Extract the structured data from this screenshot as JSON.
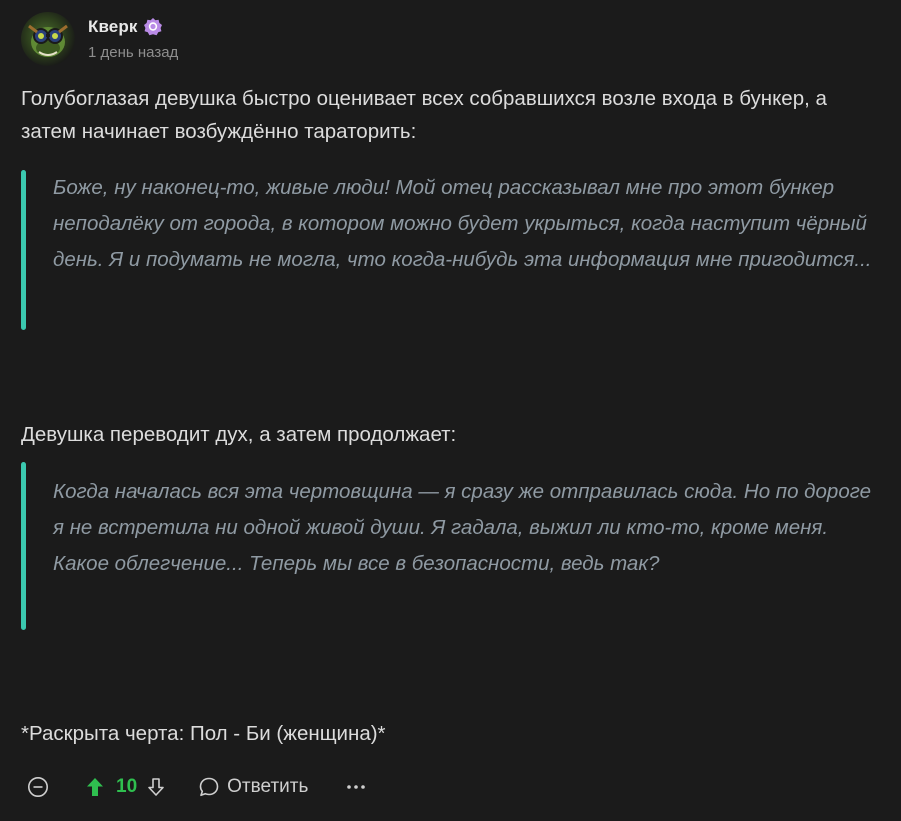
{
  "author": {
    "name": "Кверк",
    "time": "1 день назад"
  },
  "content": {
    "paragraph1": "Голубоглазая девушка быстро оценивает всех собравшихся возле входа в бункер, а затем начинает возбуждённо тараторить:",
    "quote1": "Боже, ну наконец-то, живые люди! Мой отец рассказывал мне про этот бункер неподалёку от города, в котором можно будет укрыться, когда наступит чёрный день. Я и подумать не могла, что когда-нибудь эта информация мне пригодится...",
    "paragraph2": "Девушка переводит дух, а затем продолжает:",
    "quote2": "Когда началась вся эта чертовщина — я сразу же отправилась сюда. Но по дороге я не встретила ни одной живой души. Я гадала, выжил ли кто-то, кроме меня. Какое облегчение... Теперь мы все в безопасности, ведь так?",
    "paragraph3": "*Раскрыта черта: Пол - Би (женщина)*"
  },
  "actions": {
    "score": "10",
    "reply_label": "Ответить"
  },
  "colors": {
    "background": "#1b1b1b",
    "quote_bar": "#3bc9b0",
    "quote_text": "#8f9aa3",
    "upvote": "#2fbf4f",
    "badge": "#b98be6"
  },
  "icons": {
    "collapse": "minus-circle-icon",
    "upvote": "arrow-up-icon",
    "downvote": "arrow-down-icon",
    "reply": "speech-bubble-icon",
    "more": "ellipsis-icon",
    "badge": "verified-badge-icon"
  }
}
